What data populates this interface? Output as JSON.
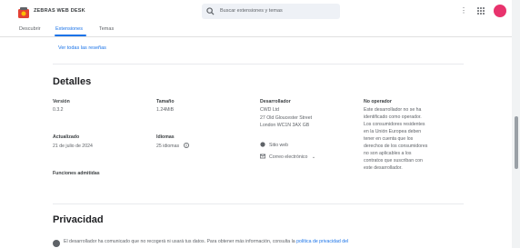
{
  "header": {
    "brand": "ZEBRAS WEB DESK",
    "search": {
      "placeholder": "Buscar extensiones y temas"
    },
    "help_icon": "help-icon",
    "apps_icon": "apps-grid-icon",
    "colors": {
      "accent": "#1a73e8",
      "avatar": "#e8336d"
    }
  },
  "tabs": [
    {
      "label": "Descubrir"
    },
    {
      "label": "Extensiones"
    },
    {
      "label": "Temas"
    }
  ],
  "see_all": "Ver todas las reseñas",
  "details": {
    "heading": "Detalles",
    "version": {
      "label": "Versión",
      "value": "0.3.2"
    },
    "updated": {
      "label": "Actualizado",
      "value": "21 de julio de 2024"
    },
    "features": {
      "label": "Funciones admitidas"
    },
    "size": {
      "label": "Tamaño",
      "value": "1.24MiB"
    },
    "languages": {
      "label": "Idiomas",
      "value": "25 idiomas"
    },
    "developer": {
      "label": "Desarrollador",
      "name": "CWD Ltd",
      "address": "27 Old Gloucester Street\nLondon WC1N 3AX GB",
      "website": "Sitio web",
      "email": "Correo electrónico"
    },
    "trader": {
      "label": "No operador",
      "text": "Este desarrollador no se ha\nidentificado como operador.\nLos consumidores residentes\nen la Unión Europea deben\ntener en cuenta que los\nderechos de los consumidores\nno son aplicables a los\ncontratos que suscriban con\neste desarrollador."
    }
  },
  "privacy": {
    "heading": "Privacidad",
    "text": "El desarrollador ha comunicado que no recogerá ni usará tus datos. Para obtener más información, consulta la ",
    "link": "política de privacidad del"
  }
}
